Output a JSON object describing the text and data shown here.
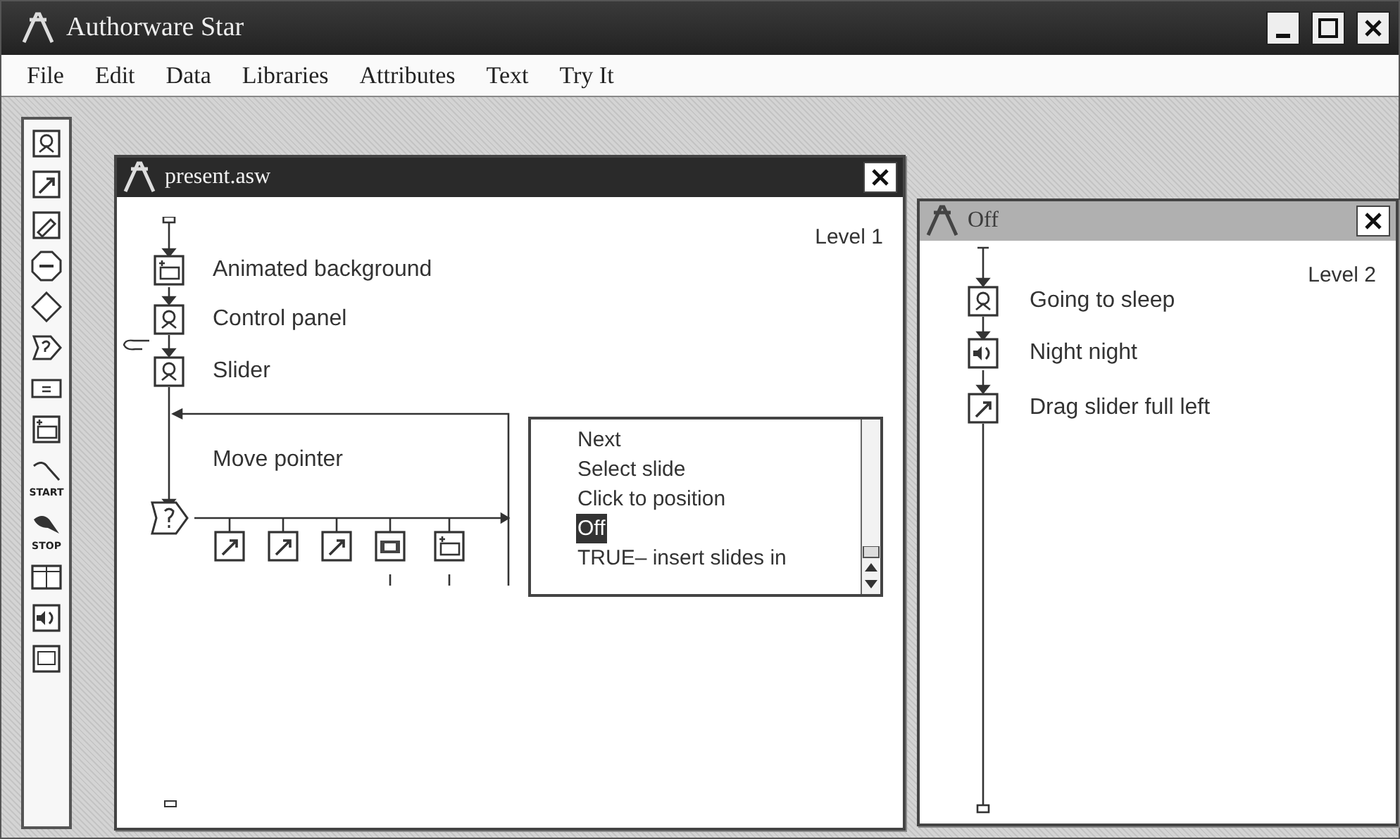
{
  "app": {
    "title": "Authorware Star"
  },
  "menu": [
    "File",
    "Edit",
    "Data",
    "Libraries",
    "Attributes",
    "Text",
    "Try It"
  ],
  "toolbar": {
    "start_label": "START",
    "stop_label": "STOP"
  },
  "flow_window": {
    "title": "present.asw",
    "active": true,
    "level_label": "Level 1",
    "icons": [
      {
        "kind": "animation",
        "label": "Animated background"
      },
      {
        "kind": "display",
        "label": "Control panel"
      },
      {
        "kind": "display",
        "label": "Slider"
      }
    ],
    "interaction": {
      "label": "Move pointer",
      "branches": [
        {
          "kind": "calc"
        },
        {
          "kind": "calc"
        },
        {
          "kind": "calc"
        },
        {
          "kind": "movie"
        },
        {
          "kind": "animation"
        }
      ]
    },
    "list": [
      {
        "label": "Next",
        "selected": false
      },
      {
        "label": "Select slide",
        "selected": false
      },
      {
        "label": "Click to position",
        "selected": false
      },
      {
        "label": "Off",
        "selected": true
      },
      {
        "label": "TRUE– insert slides in",
        "selected": false
      }
    ]
  },
  "sub_window": {
    "title": "Off",
    "active": false,
    "level_label": "Level 2",
    "icons": [
      {
        "kind": "display",
        "label": "Going to sleep"
      },
      {
        "kind": "sound",
        "label": "Night night"
      },
      {
        "kind": "calc",
        "label": "Drag slider full left"
      }
    ]
  }
}
